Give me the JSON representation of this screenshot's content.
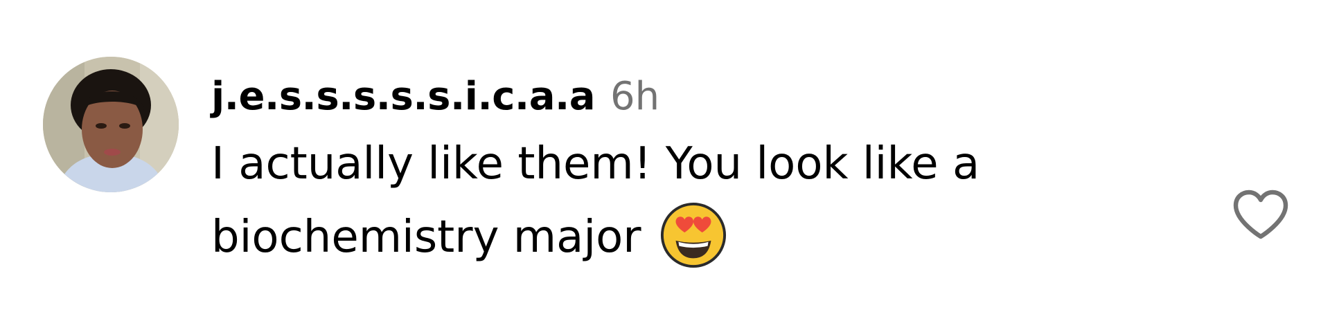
{
  "comment": {
    "username": "j.e.s.s.s.s.s.i.c.a.a",
    "timestamp": "6h",
    "text_line_1": "I actually like them! You look like a",
    "text_line_2": "biochemistry major",
    "emoji": "smiling-face-with-heart-eyes",
    "avatar": "user-profile-photo"
  },
  "actions": {
    "like_icon": "heart-outline-icon"
  },
  "colors": {
    "text": "#000000",
    "timestamp": "#737373",
    "heart_outline": "#737373",
    "background": "#ffffff"
  }
}
